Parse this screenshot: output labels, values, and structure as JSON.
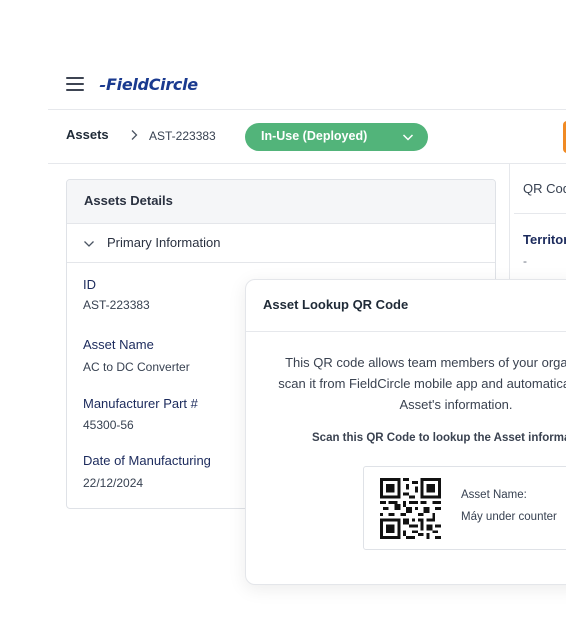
{
  "header": {
    "logo_text": "FieldCircle"
  },
  "breadcrumb": {
    "root": "Assets",
    "current": "AST-223383"
  },
  "status": {
    "label": "In-Use (Deployed)",
    "color": "#52b47a"
  },
  "details": {
    "title": "Assets Details",
    "section": "Primary Information",
    "fields": [
      {
        "label": "ID",
        "value": "AST-223383"
      },
      {
        "label": "Asset Name",
        "value": "AC to DC Converter"
      },
      {
        "label": "Manufacturer Part #",
        "value": "45300-56"
      },
      {
        "label": "Date of Manufacturing",
        "value": "22/12/2024"
      }
    ]
  },
  "side_panel": {
    "tab": "QR Code",
    "territory_label": "Territory",
    "territory_value": "-"
  },
  "modal": {
    "title": "Asset Lookup QR Code",
    "description": [
      "This QR code allows team members of your organization to",
      "scan it from FieldCircle mobile app and automatically view the",
      "Asset's information."
    ],
    "scan_text": "Scan this QR Code to lookup the Asset information",
    "asset_name_label": "Asset Name:",
    "asset_name_value": "Máy under counter"
  }
}
